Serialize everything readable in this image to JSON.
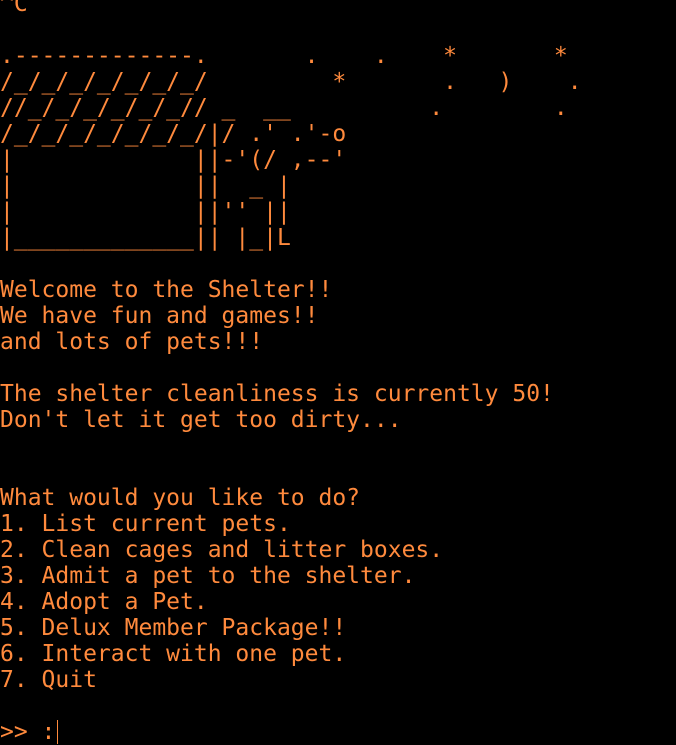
{
  "terminal": {
    "text_color": "#ff8a3d",
    "background_color": "#000000",
    "interrupt_echo": "^C",
    "art": [
      ".-------------.       .    .    *       *",
      "/_/_/_/_/_/_/_/         *       .   )    .",
      "//_/_/_/_/_/_// _  __          .        .",
      "/_/_/_/_/_/_/_/|/ .' .'-o",
      "|             ||-'(/ ,--'",
      "|             ||  _ |",
      "|             ||'' ||",
      "|_____________|| |_|L"
    ],
    "welcome": [
      "Welcome to the Shelter!!",
      "We have fun and games!!",
      "and lots of pets!!!"
    ],
    "status": [
      "The shelter cleanliness is currently 50!",
      "Don't let it get too dirty..."
    ],
    "menu_title": "What would you like to do?",
    "menu_items": [
      "1. List current pets.",
      "2. Clean cages and litter boxes.",
      "3. Admit a pet to the shelter.",
      "4. Adopt a Pet.",
      "5. Delux Member Package!!",
      "6. Interact with one pet.",
      "7. Quit"
    ],
    "prompt": ">> :"
  }
}
